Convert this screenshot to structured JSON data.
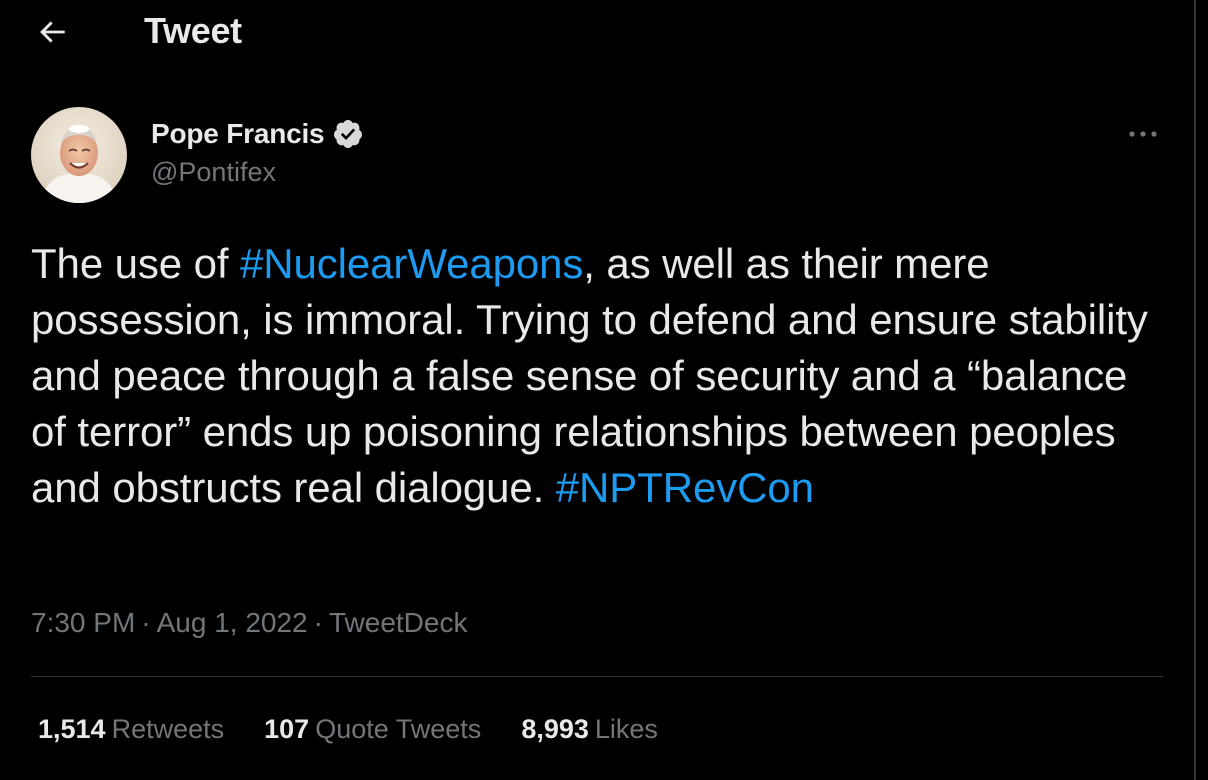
{
  "header": {
    "back_icon": "arrow-left-icon",
    "title": "Tweet"
  },
  "author": {
    "name": "Pope Francis",
    "verified_icon": "verified-badge-icon",
    "handle": "@Pontifex",
    "avatar_icon": "avatar-photo"
  },
  "more_icon": "more-horizontal-icon",
  "tweet": {
    "parts": [
      {
        "text": "The use of ",
        "type": "text"
      },
      {
        "text": "#NuclearWeapons",
        "type": "hashtag"
      },
      {
        "text": ", as well as their mere possession, is immoral. Trying to defend and ensure stability and peace through a false sense of security and a “balance of terror” ends up poisoning relationships between peoples and obstructs real dialogue. ",
        "type": "text"
      },
      {
        "text": "#NPTRevCon",
        "type": "hashtag"
      }
    ]
  },
  "meta": {
    "time": "7:30 PM",
    "separator": "·",
    "date": "Aug 1, 2022",
    "source": "TweetDeck"
  },
  "stats": {
    "retweets": {
      "count": "1,514",
      "label": "Retweets"
    },
    "quotes": {
      "count": "107",
      "label": "Quote Tweets"
    },
    "likes": {
      "count": "8,993",
      "label": "Likes"
    }
  },
  "colors": {
    "background": "#000000",
    "text": "#e7e9ea",
    "secondary": "#71767b",
    "accent": "#1d9bf0",
    "divider": "#2f3336"
  }
}
